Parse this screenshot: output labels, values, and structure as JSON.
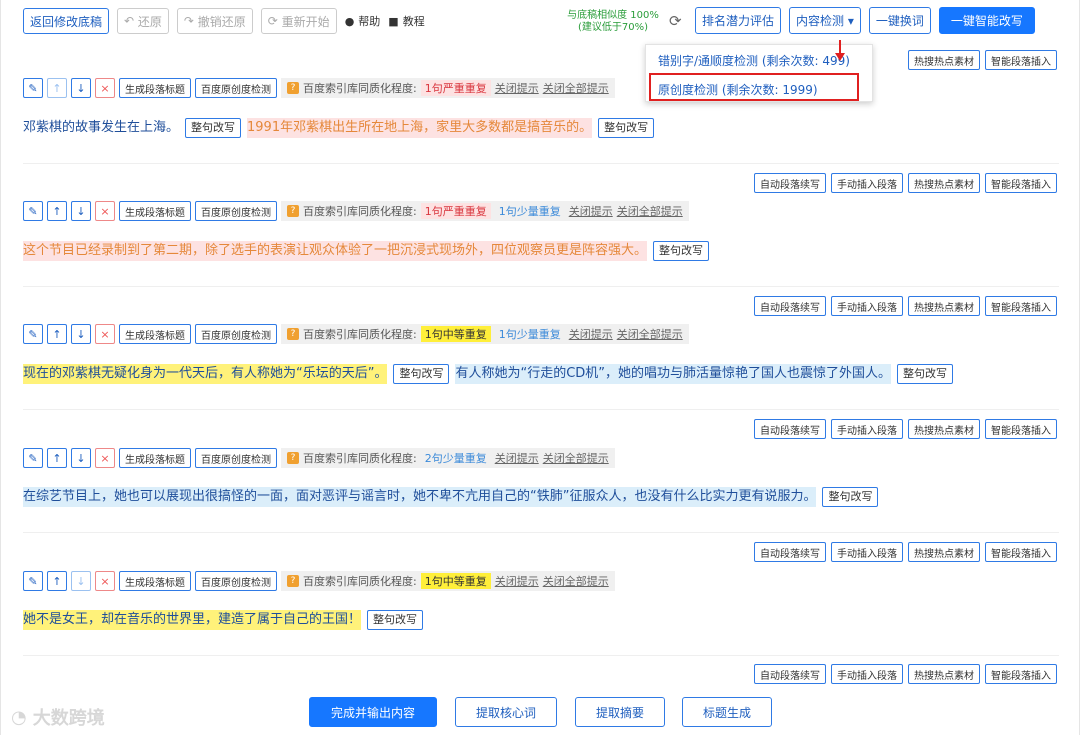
{
  "topbar": {
    "back": "返回修改底稿",
    "undo": "还原",
    "redo": "撤销还原",
    "restart": "重新开始",
    "help": "帮助",
    "tutorial": "教程",
    "similarity_line1": "与底稿相似度 100%",
    "similarity_line2": "(建议低于70%)",
    "rank": "排名潜力评估",
    "check": "内容检测",
    "replace": "一键换词",
    "rewrite": "一键智能改写"
  },
  "dropdown": {
    "item1": "错别字/通顺度检测 (剩余次数: 499)",
    "item2": "原创度检测 (剩余次数: 1999)"
  },
  "tools": {
    "auto": "自动段落续写",
    "manual": "手动插入段落",
    "hot": "热搜热点素材",
    "smart": "智能段落插入"
  },
  "ctrl": {
    "gen_title": "生成段落标题",
    "baidu": "百度原创度检测",
    "dup_label": "百度索引库同质化程度:",
    "close_tip": "关闭提示",
    "close_all": "关闭全部提示",
    "rewrite_sentence": "整句改写"
  },
  "sections": [
    {
      "tags": [
        {
          "t": "1句严重重复",
          "c": "r"
        }
      ],
      "parts": [
        "邓紫棋的故事发生在上海。",
        "1991年邓紫棋出生所在地上海，家里大多数都是搞音乐的。"
      ]
    },
    {
      "tags": [
        {
          "t": "1句严重重复",
          "c": "r"
        },
        {
          "t": "1句少量重复",
          "c": "b"
        }
      ],
      "parts": [
        "这个节目已经录制到了第二期，除了选手的表演让观众体验了一把沉浸式现场外，四位观察员更是阵容强大。"
      ]
    },
    {
      "tags": [
        {
          "t": "1句中等重复",
          "c": "y"
        },
        {
          "t": "1句少量重复",
          "c": "b"
        }
      ],
      "parts": [
        "现在的邓紫棋无疑化身为一代天后，有人称她为“乐坛的天后”。",
        "有人称她为“行走的CD机”，她的唱功与肺活量惊艳了国人也震惊了外国人。"
      ]
    },
    {
      "tags": [
        {
          "t": "2句少量重复",
          "c": "b"
        }
      ],
      "parts": [
        "在综艺节目上，她也可以展现出很搞怪的一面，面对恶评与谣言时，她不卑不亢用自己的“铁肺”征服众人，也没有什么比实力更有说服力。"
      ]
    },
    {
      "tags": [
        {
          "t": "1句中等重复",
          "c": "y"
        }
      ],
      "parts": [
        "她不是女王，却在音乐的世界里，建造了属于自己的王国！"
      ]
    }
  ],
  "bottom": {
    "finish": "完成并输出内容",
    "keywords": "提取核心词",
    "summary": "提取摘要",
    "title_gen": "标题生成"
  },
  "watermark": "大数跨境"
}
